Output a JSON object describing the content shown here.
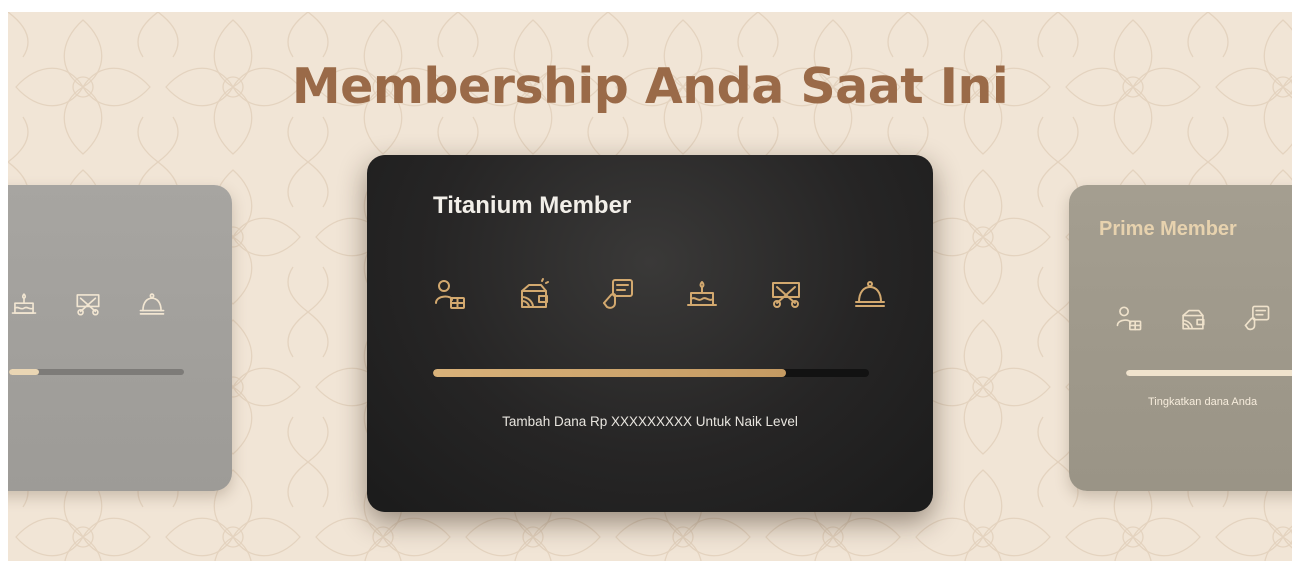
{
  "page": {
    "heading": "Membership Anda Saat Ini"
  },
  "cards": {
    "current": {
      "title": "Titanium Member",
      "message": "Tambah Dana Rp XXXXXXXXX Untuk Naik Level",
      "progress_percent": 81
    },
    "previous": {
      "progress_percent": 17
    },
    "next": {
      "title": "Prime Member",
      "message": "Tingkatkan dana Anda",
      "progress_percent": 100
    }
  },
  "benefit_icons": [
    "member-account-icon",
    "wallet-icon",
    "voucher-icon",
    "birthday-cake-icon",
    "dining-icon",
    "cloche-icon"
  ],
  "colors": {
    "background": "#f1e5d6",
    "heading": "#9a6a48",
    "accent_gold": "#d0a56b",
    "card_dark": "#252424"
  }
}
